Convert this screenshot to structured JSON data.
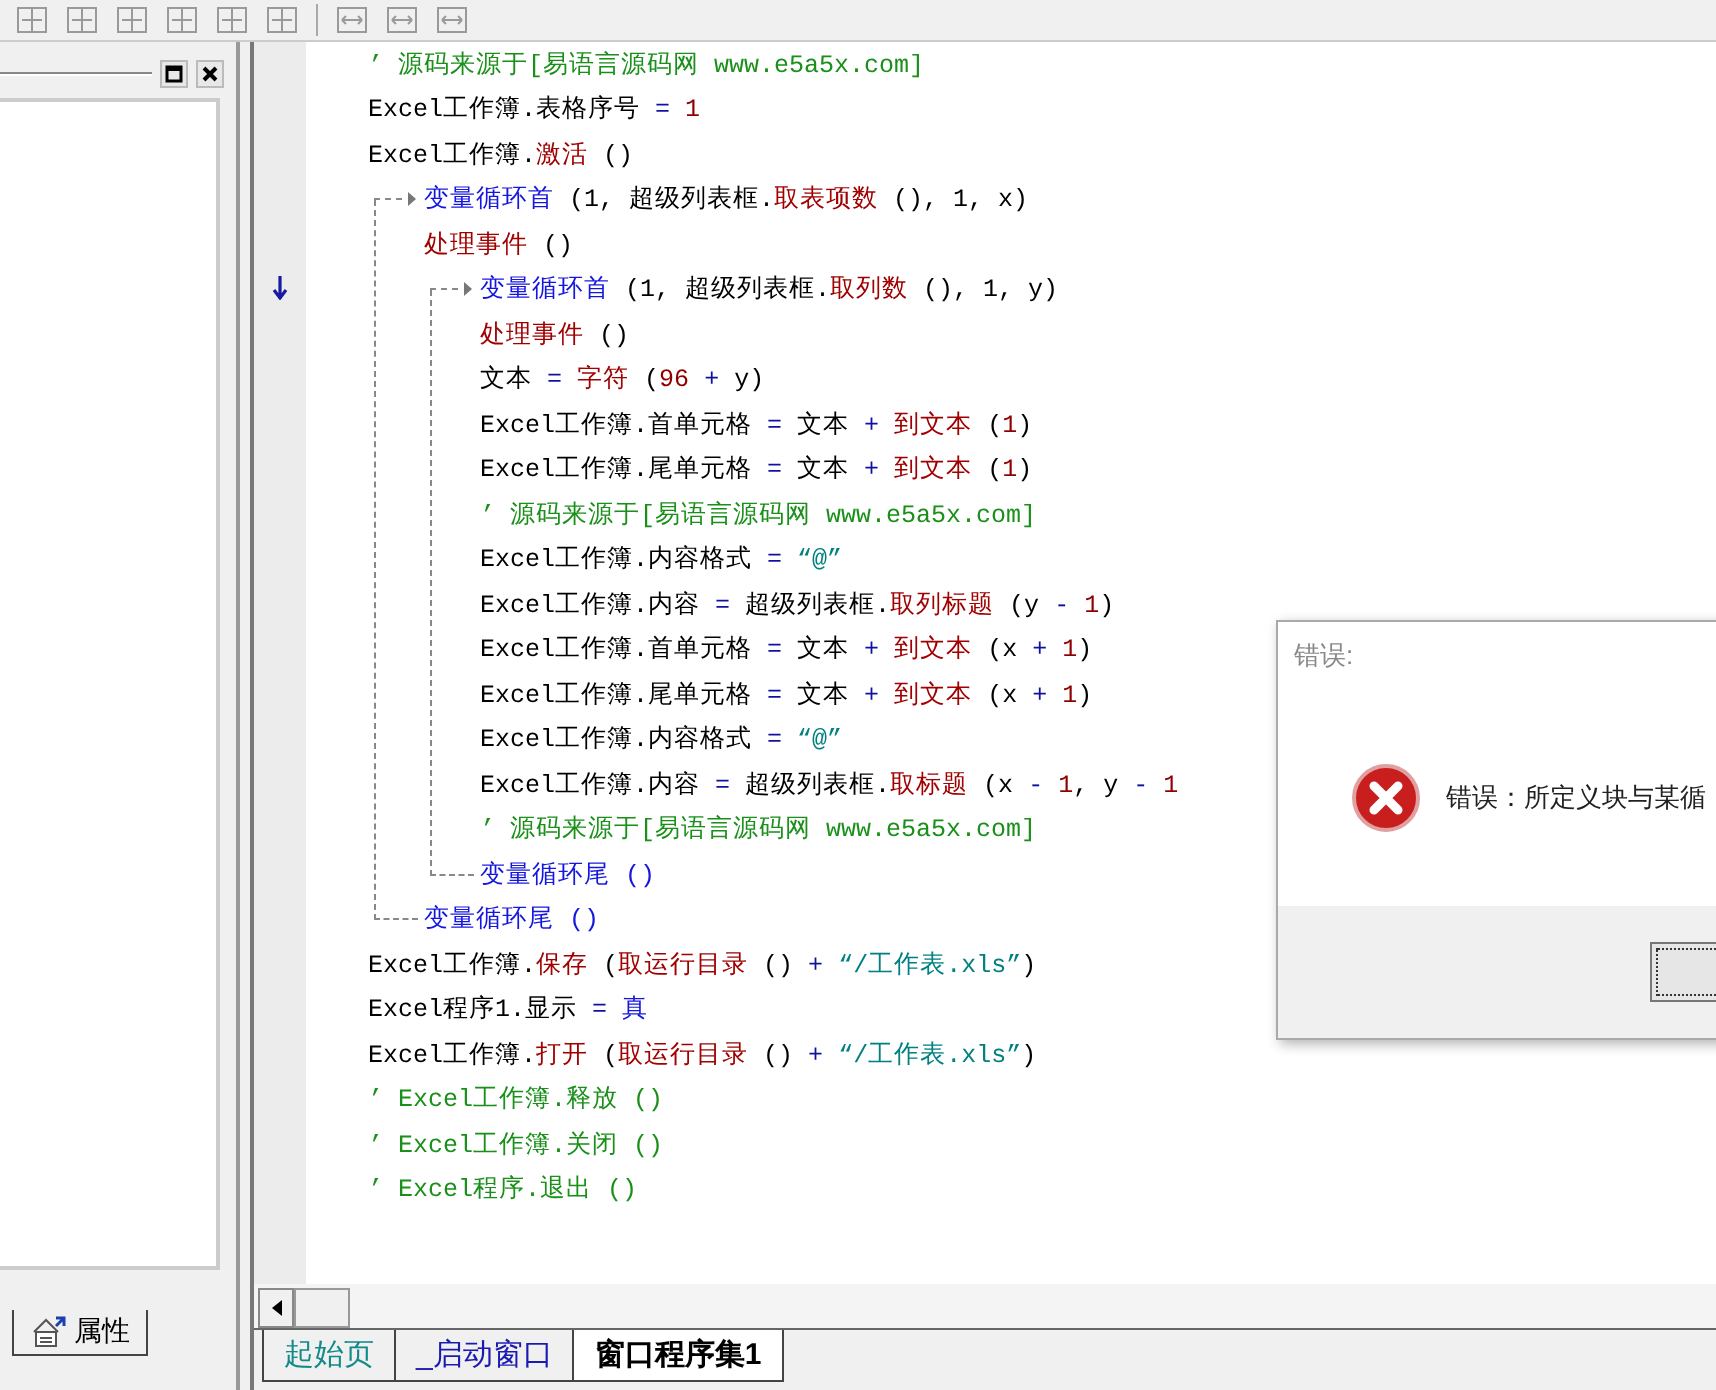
{
  "left_panel": {
    "tab": "属性"
  },
  "code": [
    {
      "kind": "line",
      "segments": [
        {
          "kind": "comment",
          "text": "’ 源码来源于[易语言源码网 www.e5a5x.com]"
        }
      ]
    },
    {
      "kind": "line",
      "segments": [
        {
          "kind": "plain",
          "text": "Excel工作簿.表格序号 "
        },
        {
          "kind": "op",
          "text": "= "
        },
        {
          "kind": "num",
          "text": "1"
        }
      ]
    },
    {
      "kind": "line",
      "segments": [
        {
          "kind": "plain",
          "text": "Excel工作簿."
        },
        {
          "kind": "call",
          "text": "激活"
        },
        {
          "kind": "plain",
          "text": " ()"
        }
      ]
    },
    {
      "kind": "loop",
      "head": [
        {
          "kind": "cmd",
          "text": "变量循环首"
        },
        {
          "kind": "plain",
          "text": " (1, 超级列表框."
        },
        {
          "kind": "call",
          "text": "取表项数"
        },
        {
          "kind": "plain",
          "text": " (), 1, x)"
        }
      ],
      "children": [
        {
          "kind": "line",
          "segments": [
            {
              "kind": "call",
              "text": "处理事件"
            },
            {
              "kind": "plain",
              "text": " ()"
            }
          ]
        },
        {
          "kind": "loop",
          "head": [
            {
              "kind": "cmd",
              "text": "变量循环首"
            },
            {
              "kind": "plain",
              "text": " (1, 超级列表框."
            },
            {
              "kind": "call",
              "text": "取列数"
            },
            {
              "kind": "plain",
              "text": " (), 1, y)"
            }
          ],
          "children": [
            {
              "kind": "line",
              "segments": [
                {
                  "kind": "call",
                  "text": "处理事件"
                },
                {
                  "kind": "plain",
                  "text": " ()"
                }
              ]
            },
            {
              "kind": "line",
              "segments": [
                {
                  "kind": "plain",
                  "text": "文本 "
                },
                {
                  "kind": "op",
                  "text": "= "
                },
                {
                  "kind": "call",
                  "text": "字符"
                },
                {
                  "kind": "plain",
                  "text": " ("
                },
                {
                  "kind": "num",
                  "text": "96"
                },
                {
                  "kind": "op",
                  "text": " + "
                },
                {
                  "kind": "plain",
                  "text": "y)"
                }
              ]
            },
            {
              "kind": "line",
              "segments": [
                {
                  "kind": "plain",
                  "text": "Excel工作簿.首单元格 "
                },
                {
                  "kind": "op",
                  "text": "= "
                },
                {
                  "kind": "plain",
                  "text": "文本 "
                },
                {
                  "kind": "op",
                  "text": "+ "
                },
                {
                  "kind": "call",
                  "text": "到文本"
                },
                {
                  "kind": "plain",
                  "text": " ("
                },
                {
                  "kind": "num",
                  "text": "1"
                },
                {
                  "kind": "plain",
                  "text": ")"
                }
              ]
            },
            {
              "kind": "line",
              "segments": [
                {
                  "kind": "plain",
                  "text": "Excel工作簿.尾单元格 "
                },
                {
                  "kind": "op",
                  "text": "= "
                },
                {
                  "kind": "plain",
                  "text": "文本 "
                },
                {
                  "kind": "op",
                  "text": "+ "
                },
                {
                  "kind": "call",
                  "text": "到文本"
                },
                {
                  "kind": "plain",
                  "text": " ("
                },
                {
                  "kind": "num",
                  "text": "1"
                },
                {
                  "kind": "plain",
                  "text": ")"
                }
              ]
            },
            {
              "kind": "line",
              "segments": [
                {
                  "kind": "comment",
                  "text": "’ 源码来源于[易语言源码网 www.e5a5x.com]"
                }
              ]
            },
            {
              "kind": "line",
              "segments": [
                {
                  "kind": "plain",
                  "text": "Excel工作簿.内容格式 "
                },
                {
                  "kind": "op",
                  "text": "= "
                },
                {
                  "kind": "str",
                  "text": "“@”"
                }
              ]
            },
            {
              "kind": "line",
              "segments": [
                {
                  "kind": "plain",
                  "text": "Excel工作簿.内容 "
                },
                {
                  "kind": "op",
                  "text": "= "
                },
                {
                  "kind": "plain",
                  "text": "超级列表框."
                },
                {
                  "kind": "call",
                  "text": "取列标题"
                },
                {
                  "kind": "plain",
                  "text": " (y "
                },
                {
                  "kind": "op",
                  "text": "- "
                },
                {
                  "kind": "num",
                  "text": "1"
                },
                {
                  "kind": "plain",
                  "text": ")"
                }
              ]
            },
            {
              "kind": "line",
              "segments": [
                {
                  "kind": "plain",
                  "text": "Excel工作簿.首单元格 "
                },
                {
                  "kind": "op",
                  "text": "= "
                },
                {
                  "kind": "plain",
                  "text": "文本 "
                },
                {
                  "kind": "op",
                  "text": "+ "
                },
                {
                  "kind": "call",
                  "text": "到文本"
                },
                {
                  "kind": "plain",
                  "text": " (x "
                },
                {
                  "kind": "op",
                  "text": "+ "
                },
                {
                  "kind": "num",
                  "text": "1"
                },
                {
                  "kind": "plain",
                  "text": ")"
                }
              ]
            },
            {
              "kind": "line",
              "segments": [
                {
                  "kind": "plain",
                  "text": "Excel工作簿.尾单元格 "
                },
                {
                  "kind": "op",
                  "text": "= "
                },
                {
                  "kind": "plain",
                  "text": "文本 "
                },
                {
                  "kind": "op",
                  "text": "+ "
                },
                {
                  "kind": "call",
                  "text": "到文本"
                },
                {
                  "kind": "plain",
                  "text": " (x "
                },
                {
                  "kind": "op",
                  "text": "+ "
                },
                {
                  "kind": "num",
                  "text": "1"
                },
                {
                  "kind": "plain",
                  "text": ")"
                }
              ]
            },
            {
              "kind": "line",
              "segments": [
                {
                  "kind": "plain",
                  "text": "Excel工作簿.内容格式 "
                },
                {
                  "kind": "op",
                  "text": "= "
                },
                {
                  "kind": "str",
                  "text": "“@”"
                }
              ]
            },
            {
              "kind": "line",
              "segments": [
                {
                  "kind": "plain",
                  "text": "Excel工作簿.内容 "
                },
                {
                  "kind": "op",
                  "text": "= "
                },
                {
                  "kind": "plain",
                  "text": "超级列表框."
                },
                {
                  "kind": "call",
                  "text": "取标题"
                },
                {
                  "kind": "plain",
                  "text": " (x "
                },
                {
                  "kind": "op",
                  "text": "- "
                },
                {
                  "kind": "num",
                  "text": "1"
                },
                {
                  "kind": "plain",
                  "text": ", y "
                },
                {
                  "kind": "op",
                  "text": "- "
                },
                {
                  "kind": "num",
                  "text": "1"
                }
              ]
            },
            {
              "kind": "line",
              "segments": [
                {
                  "kind": "comment",
                  "text": "’ 源码来源于[易语言源码网 www.e5a5x.com]"
                }
              ]
            }
          ],
          "tail": [
            {
              "kind": "cmd",
              "text": "变量循环尾"
            },
            {
              "kind": "cmd",
              "text": " ()"
            }
          ]
        }
      ],
      "tail": [
        {
          "kind": "cmd",
          "text": "变量循环尾"
        },
        {
          "kind": "cmd",
          "text": " ()"
        }
      ]
    },
    {
      "kind": "line",
      "segments": [
        {
          "kind": "plain",
          "text": "Excel工作簿."
        },
        {
          "kind": "call",
          "text": "保存"
        },
        {
          "kind": "plain",
          "text": " ("
        },
        {
          "kind": "call",
          "text": "取运行目录"
        },
        {
          "kind": "plain",
          "text": " () "
        },
        {
          "kind": "op",
          "text": "+ "
        },
        {
          "kind": "str",
          "text": "“/工作表.xls”"
        },
        {
          "kind": "plain",
          "text": ")"
        }
      ]
    },
    {
      "kind": "line",
      "segments": [
        {
          "kind": "plain",
          "text": "Excel程序1.显示 "
        },
        {
          "kind": "op",
          "text": "= "
        },
        {
          "kind": "cmd",
          "text": "真"
        }
      ]
    },
    {
      "kind": "line",
      "segments": [
        {
          "kind": "plain",
          "text": "Excel工作簿."
        },
        {
          "kind": "call",
          "text": "打开"
        },
        {
          "kind": "plain",
          "text": " ("
        },
        {
          "kind": "call",
          "text": "取运行目录"
        },
        {
          "kind": "plain",
          "text": " () "
        },
        {
          "kind": "op",
          "text": "+ "
        },
        {
          "kind": "str",
          "text": "“/工作表.xls”"
        },
        {
          "kind": "plain",
          "text": ")"
        }
      ]
    },
    {
      "kind": "line",
      "segments": [
        {
          "kind": "comment",
          "text": "’ Excel工作簿.释放 ()"
        }
      ]
    },
    {
      "kind": "line",
      "segments": [
        {
          "kind": "comment",
          "text": "’ Excel工作簿.关闭 ()"
        }
      ]
    },
    {
      "kind": "line",
      "segments": [
        {
          "kind": "comment",
          "text": "’ Excel程序.退出 ()"
        }
      ]
    }
  ],
  "tabs": [
    {
      "label": "起始页",
      "kind": "page",
      "selected": false
    },
    {
      "label": "_启动窗口",
      "kind": "window",
      "selected": false
    },
    {
      "label": "窗口程序集1",
      "kind": "class",
      "selected": true
    }
  ],
  "dialog": {
    "title": "错误:",
    "message": "错误：所定义块与某循"
  }
}
